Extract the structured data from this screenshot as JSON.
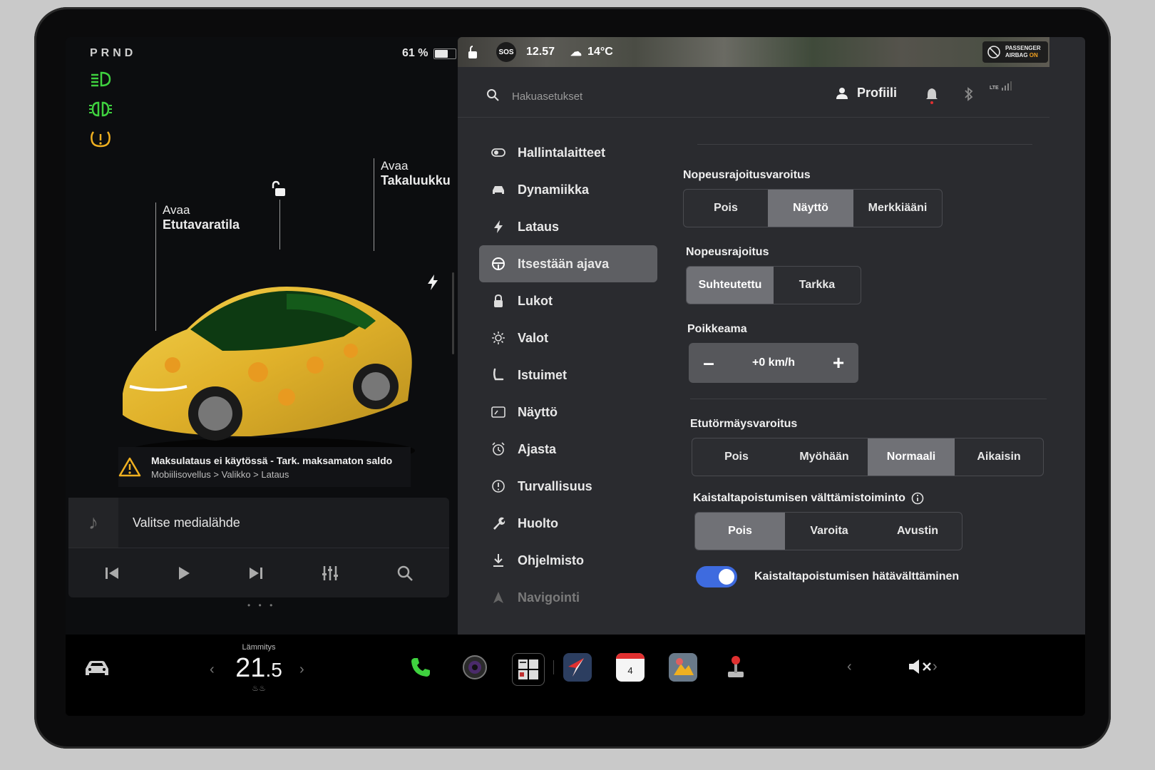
{
  "left": {
    "gear": "PRND",
    "battery_percent": "61 %",
    "battery_level": 0.61,
    "callout_front": {
      "line1": "Avaa",
      "line2": "Etutavaratila"
    },
    "callout_rear": {
      "line1": "Avaa",
      "line2": "Takaluukku"
    },
    "alert": {
      "title": "Maksulataus ei käytössä - Tark. maksamaton saldo",
      "path": "Mobiilisovellus > Valikko > Lataus"
    },
    "media": {
      "title": "Valitse medialähde"
    },
    "page_dots": "• • •"
  },
  "status": {
    "sos": "SOS",
    "time": "12.57",
    "temperature": "14°C",
    "airbag_line1": "PASSENGER",
    "airbag_line2": "AIRBAG",
    "airbag_state": "ON"
  },
  "search": {
    "placeholder": "Hakuasetukset"
  },
  "profile": {
    "label": "Profiili"
  },
  "lte": "LTE",
  "menu": [
    {
      "label": "Hallintalaitteet",
      "icon": "toggle-icon"
    },
    {
      "label": "Dynamiikka",
      "icon": "car-icon"
    },
    {
      "label": "Lataus",
      "icon": "bolt-icon"
    },
    {
      "label": "Itsestään ajava",
      "icon": "steering-wheel-icon",
      "active": true
    },
    {
      "label": "Lukot",
      "icon": "lock-icon"
    },
    {
      "label": "Valot",
      "icon": "sun-icon"
    },
    {
      "label": "Istuimet",
      "icon": "seat-icon"
    },
    {
      "label": "Näyttö",
      "icon": "display-icon"
    },
    {
      "label": "Ajasta",
      "icon": "alarm-icon"
    },
    {
      "label": "Turvallisuus",
      "icon": "info-circle-icon"
    },
    {
      "label": "Huolto",
      "icon": "wrench-icon"
    },
    {
      "label": "Ohjelmisto",
      "icon": "download-icon"
    },
    {
      "label": "Navigointi",
      "icon": "navigation-icon"
    }
  ],
  "settings": {
    "speed_warning": {
      "label": "Nopeusrajoitusvaroitus",
      "options": [
        "Pois",
        "Näyttö",
        "Merkkiääni"
      ],
      "selected": 1
    },
    "speed_limit": {
      "label": "Nopeusrajoitus",
      "options": [
        "Suhteutettu",
        "Tarkka"
      ],
      "selected": 0
    },
    "offset": {
      "label": "Poikkeama",
      "value": "+0 km/h",
      "minus": "–",
      "plus": "+"
    },
    "collision_warning": {
      "label": "Etutörmäysvaroitus",
      "options": [
        "Pois",
        "Myöhään",
        "Normaali",
        "Aikaisin"
      ],
      "selected": 2
    },
    "lane_departure": {
      "label": "Kaistaltapoistumisen välttämistoiminto",
      "options": [
        "Pois",
        "Varoita",
        "Avustin"
      ],
      "selected": 0
    },
    "lane_emergency": {
      "label": "Kaistaltapoistumisen hätävälttäminen",
      "enabled": true
    }
  },
  "dock": {
    "climate_label": "Lämmitys",
    "climate_temp_int": "21",
    "climate_temp_dec": ".5",
    "calendar_day": "4"
  },
  "colors": {
    "accent_blue": "#3e6bdf",
    "indicator_green": "#3fd13f",
    "warning_amber": "#f0b020"
  }
}
